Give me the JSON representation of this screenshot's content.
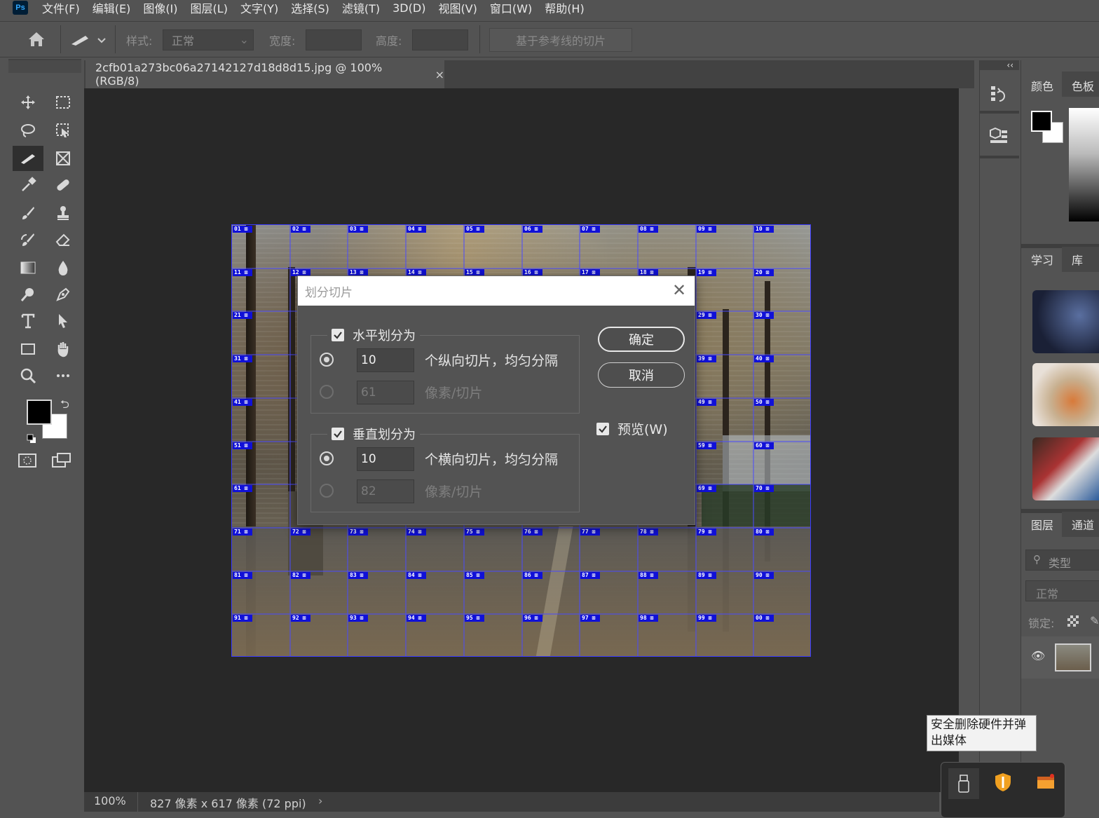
{
  "app": {
    "logo": "Ps"
  },
  "menu": [
    "文件(F)",
    "编辑(E)",
    "图像(I)",
    "图层(L)",
    "文字(Y)",
    "选择(S)",
    "滤镜(T)",
    "3D(D)",
    "视图(V)",
    "窗口(W)",
    "帮助(H)"
  ],
  "options": {
    "style_label": "样式:",
    "style_value": "正常",
    "width_label": "宽度:",
    "height_label": "高度:",
    "guides_button": "基于参考线的切片"
  },
  "panels": {
    "collapse_left": "‹‹",
    "collapse_right": "‹‹"
  },
  "document": {
    "tab_title": "2cfb01a273bc06a27142127d18d8d15.jpg @ 100%(RGB/8)",
    "zoom": "100%",
    "info": "827 像素 x 617 像素 (72 ppi)",
    "info_arrow": "›"
  },
  "slices": [
    "01",
    "02",
    "03",
    "04",
    "05",
    "06",
    "07",
    "08",
    "09",
    "10",
    "11",
    "12",
    "13",
    "14",
    "15",
    "16",
    "17",
    "18",
    "19",
    "20",
    "21",
    "29",
    "30",
    "31",
    "39",
    "40",
    "41",
    "49",
    "50",
    "51",
    "59",
    "60",
    "61",
    "69",
    "70",
    "71",
    "72",
    "73",
    "74",
    "75",
    "76",
    "77",
    "78",
    "79",
    "80",
    "81",
    "82",
    "83",
    "84",
    "85",
    "86",
    "87",
    "88",
    "89",
    "90",
    "91",
    "92",
    "93",
    "94",
    "95",
    "96",
    "97",
    "98",
    "99",
    "00"
  ],
  "dialog": {
    "title": "划分切片",
    "horizontal_label": "水平划分为",
    "h_count": "10",
    "h_count_label": "个纵向切片，均匀分隔",
    "h_pixels": "61",
    "h_pixels_label": "像素/切片",
    "vertical_label": "垂直划分为",
    "v_count": "10",
    "v_count_label": "个横向切片，均匀分隔",
    "v_pixels": "82",
    "v_pixels_label": "像素/切片",
    "ok_button": "确定",
    "cancel_button": "取消",
    "preview_label": "预览(W)"
  },
  "right_panel": {
    "tab_color": "颜色",
    "tab_swatches": "色板",
    "tab_learn": "学习",
    "tab_library": "库",
    "tab_layers": "图层",
    "tab_channels": "通道",
    "search_placeholder": "类型",
    "blend_mode": "正常",
    "lock_label": "锁定:"
  },
  "tooltip": "安全删除硬件并弹出媒体"
}
